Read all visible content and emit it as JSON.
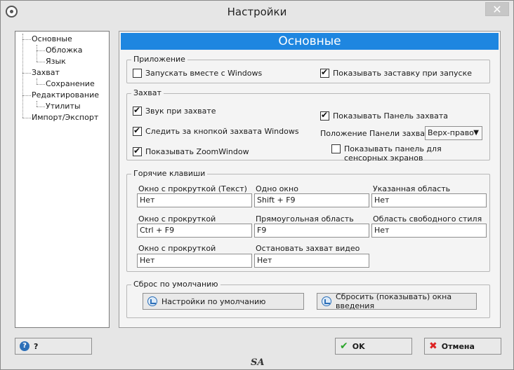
{
  "window": {
    "title": "Настройки",
    "close_glyph": "✕",
    "logo_text": "SA"
  },
  "icons": {
    "app": "app-logo-icon",
    "close": "close-icon",
    "restore": "restore-icon",
    "help": "help-icon",
    "ok": "check-icon",
    "cancel": "x-icon"
  },
  "colors": {
    "accent": "#1e86e0"
  },
  "tree": {
    "items": [
      {
        "label": "Основные",
        "level": 0
      },
      {
        "label": "Обложка",
        "level": 1
      },
      {
        "label": "Язык",
        "level": 1
      },
      {
        "label": "Захват",
        "level": 0
      },
      {
        "label": "Сохранение",
        "level": 1
      },
      {
        "label": "Редактирование",
        "level": 0
      },
      {
        "label": "Утилиты",
        "level": 1
      },
      {
        "label": "Импорт/Экспорт",
        "level": 0
      }
    ]
  },
  "page": {
    "header": "Основные"
  },
  "app_group": {
    "legend": "Приложение",
    "start_with_windows": {
      "label": "Запускать вместе с Windows",
      "checked": false
    },
    "show_splash": {
      "label": "Показывать заставку при запуске",
      "checked": true
    }
  },
  "capture_group": {
    "legend": "Захват",
    "sound": {
      "label": "Звук при захвате",
      "checked": true
    },
    "follow_button": {
      "label": "Следить за кнопкой захвата Windows",
      "checked": true
    },
    "zoom_window": {
      "label": "Показывать ZoomWindow",
      "checked": true
    },
    "show_panel": {
      "label": "Показывать Панель захвата",
      "checked": true
    },
    "panel_position_label": "Положение Панели захвата",
    "panel_position_value": "Верх-право",
    "touch_panel": {
      "label": "Показывать панель для сенсорных экранов",
      "checked": false
    }
  },
  "hotkeys_group": {
    "legend": "Горячие клавиши",
    "rows": [
      [
        {
          "label": "Окно с прокруткой (Текст)",
          "value": "Нет"
        },
        {
          "label": "Одно окно",
          "value": "Shift + F9"
        },
        {
          "label": "Указанная область",
          "value": "Нет"
        }
      ],
      [
        {
          "label": "Окно с прокруткой",
          "value": "Ctrl + F9"
        },
        {
          "label": "Прямоугольная область",
          "value": "F9"
        },
        {
          "label": "Область свободного стиля",
          "value": "Нет"
        }
      ],
      [
        {
          "label": "Окно с прокруткой",
          "value": "Нет"
        },
        {
          "label": "Остановать захват видео",
          "value": "Нет"
        }
      ]
    ]
  },
  "reset_group": {
    "legend": "Сброс по умолчанию",
    "defaults_button": "Настройки по умолчанию",
    "reset_intro_button": "Сбросить (показывать) окна введения"
  },
  "footer": {
    "help_button": "?",
    "ok_button": "OK",
    "cancel_button": "Отмена"
  }
}
